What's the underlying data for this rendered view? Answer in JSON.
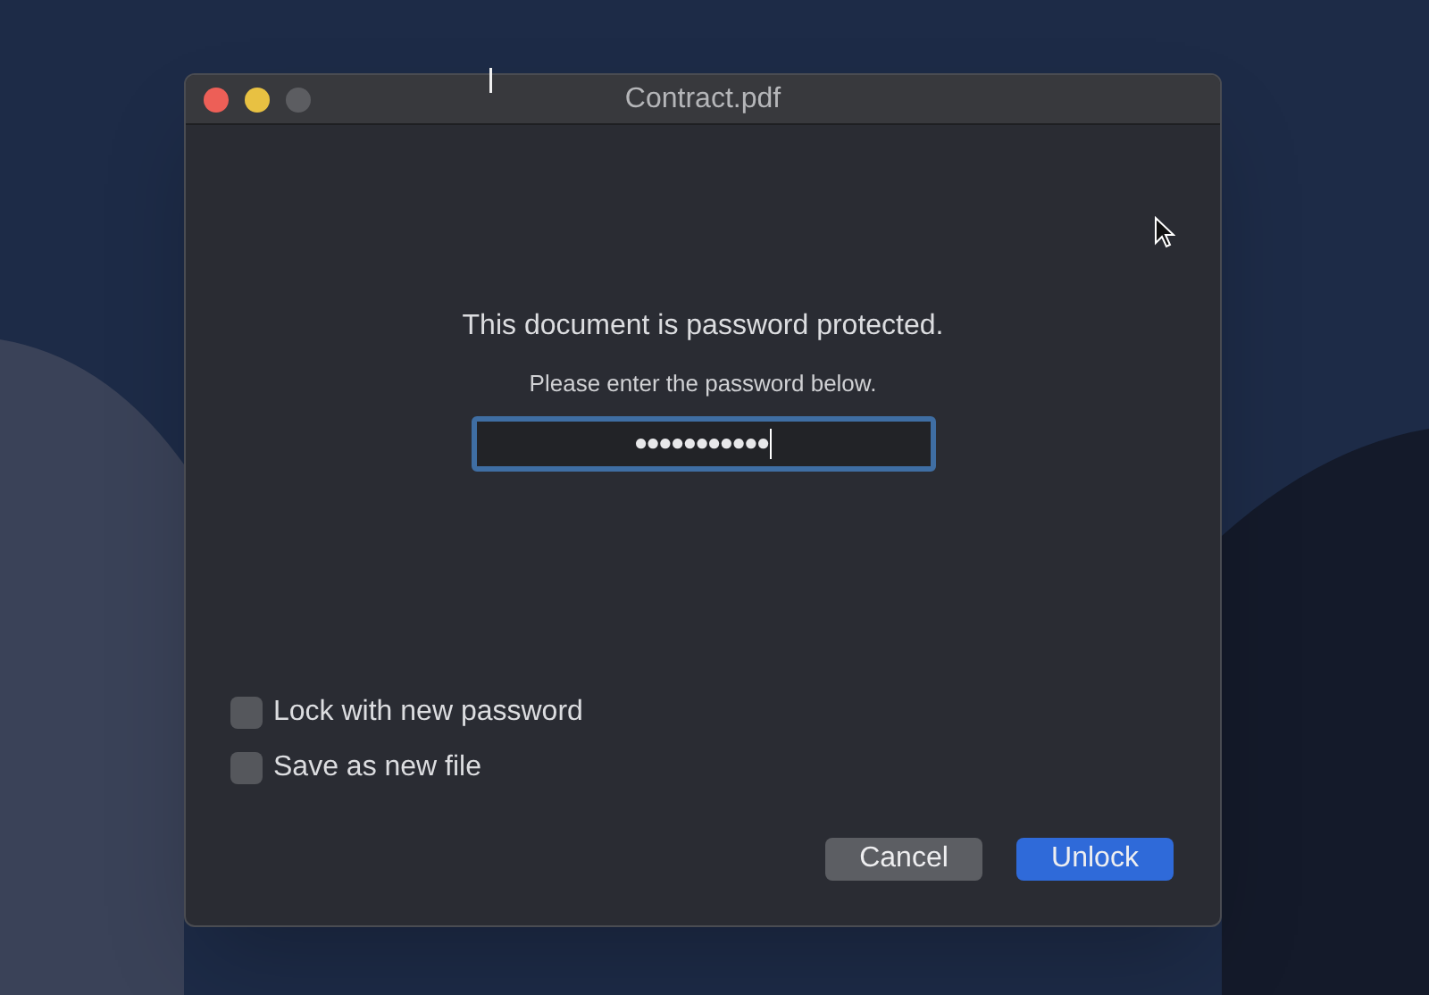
{
  "window": {
    "title": "Contract.pdf"
  },
  "message": "This document is password protected.",
  "prompt": "Please enter the password below.",
  "password_field": {
    "value": "●●●●●●●●●●●",
    "focused": true
  },
  "options": [
    {
      "label": "Lock with new password",
      "checked": false
    },
    {
      "label": "Save as new file",
      "checked": false
    }
  ],
  "buttons": [
    {
      "label": "Cancel",
      "default": false
    },
    {
      "label": "Unlock",
      "default": true
    }
  ]
}
